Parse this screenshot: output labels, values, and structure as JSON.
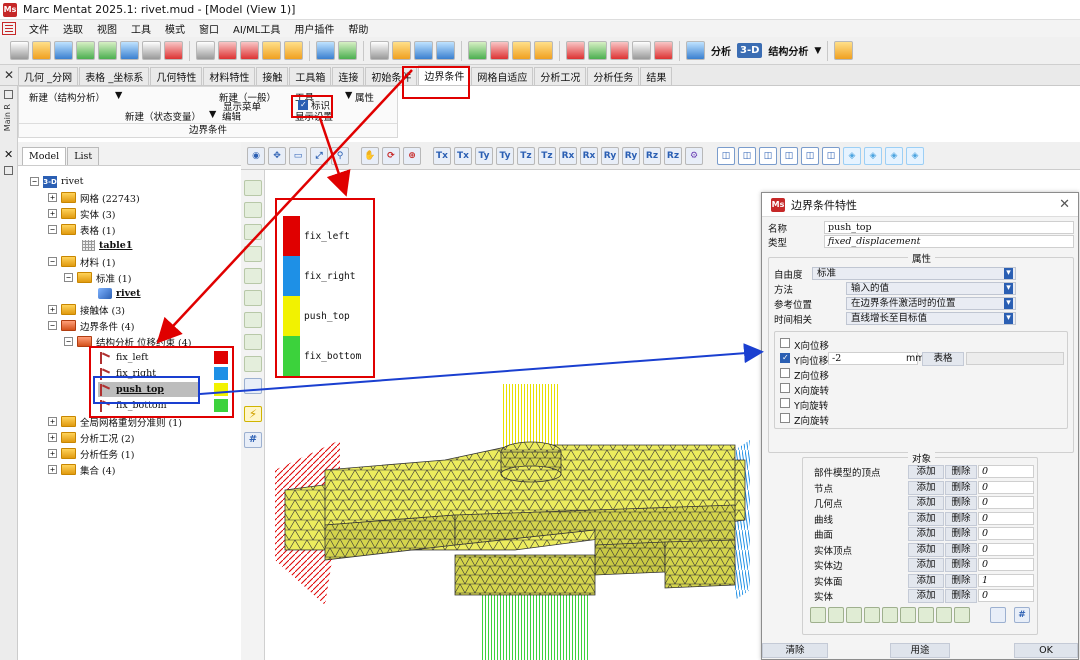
{
  "window": {
    "title": "Marc Mentat 2025.1: rivet.mud - [Model (View 1)]",
    "app_icon": "Ms"
  },
  "menubar": {
    "items": [
      "文件",
      "选取",
      "视图",
      "工具",
      "模式",
      "窗口",
      "AI/ML工具",
      "用户插件",
      "帮助"
    ]
  },
  "toolbar": {
    "analysis_label": "分析",
    "mode_3d": "3-D",
    "analysis_type": "结构分析"
  },
  "tabs": [
    "几何 _分网",
    "表格 _坐标系",
    "几何特性",
    "材料特性",
    "接触",
    "工具箱",
    "连接",
    "初始条件",
    "边界条件",
    "网格自适应",
    "分析工况",
    "分析任务",
    "结果"
  ],
  "active_tab": "边界条件",
  "ribbon": {
    "new_structural": "新建（结构分析）",
    "new_general": "新建（一般）",
    "tools": "工具",
    "properties": "属性",
    "show_menu": "显示菜单",
    "new_state_var": "新建（状态变量）",
    "edit": "编辑",
    "show_settings": "显示设置",
    "label_checkbox": "标识",
    "group_title": "边界条件",
    "side_label": "Main R"
  },
  "panel": {
    "tabs": [
      "Model",
      "List"
    ],
    "tree": {
      "root": "rivet",
      "root_badge": "3-D",
      "items": [
        {
          "label": "网格 (22743)"
        },
        {
          "label": "实体 (3)"
        },
        {
          "label": "表格 (1)"
        },
        {
          "label": "table1"
        },
        {
          "label": "材料 (1)"
        },
        {
          "label": "标准 (1)"
        },
        {
          "label": "rivet"
        },
        {
          "label": "接触体 (3)"
        },
        {
          "label": "边界条件 (4)"
        },
        {
          "label": "结构分析 位移约束 (4)"
        },
        {
          "label": "fix_left",
          "color": "#e00000"
        },
        {
          "label": "fix_right",
          "color": "#1e90e6"
        },
        {
          "label": "push_top",
          "color": "#f2f200"
        },
        {
          "label": "fix_bottom",
          "color": "#3cd23c"
        },
        {
          "label": "全局网格重划分准则 (1)"
        },
        {
          "label": "分析工况 (2)"
        },
        {
          "label": "分析任务 (1)"
        },
        {
          "label": "集合 (4)"
        }
      ]
    }
  },
  "legend": {
    "items": [
      {
        "label": "fix_left",
        "color": "#e00000"
      },
      {
        "label": "fix_right",
        "color": "#1e90e6"
      },
      {
        "label": "push_top",
        "color": "#f2f200"
      },
      {
        "label": "fix_bottom",
        "color": "#3cd23c"
      }
    ]
  },
  "viewport_toolbar": {
    "buttons": [
      "Tx",
      "Tx",
      "Ty",
      "Ty",
      "Tz",
      "Tz",
      "Rx",
      "Rx",
      "Ry",
      "Ry",
      "Rz",
      "Rz"
    ]
  },
  "dialog": {
    "title": "边界条件特性",
    "name_label": "名称",
    "name_value": "push_top",
    "type_label": "类型",
    "type_value": "fixed_displacement",
    "attr_group": "属性",
    "dof_label": "自由度",
    "dof_value": "标准",
    "method_label": "方法",
    "method_value": "输入的值",
    "ref_label": "参考位置",
    "ref_value": "在边界条件激活时的位置",
    "time_label": "时间相关",
    "time_value": "直线增长至目标值",
    "dofs": [
      {
        "label": "X向位移",
        "checked": false
      },
      {
        "label": "Y向位移",
        "checked": true,
        "value": "-2",
        "unit": "mm",
        "table_btn": "表格"
      },
      {
        "label": "Z向位移",
        "checked": false
      },
      {
        "label": "X向旋转",
        "checked": false
      },
      {
        "label": "Y向旋转",
        "checked": false
      },
      {
        "label": "Z向旋转",
        "checked": false
      }
    ],
    "objects_group": "对象",
    "add_label": "添加",
    "remove_label": "删除",
    "objects": [
      {
        "label": "部件模型的顶点",
        "count": "0"
      },
      {
        "label": "节点",
        "count": "0"
      },
      {
        "label": "几何点",
        "count": "0"
      },
      {
        "label": "曲线",
        "count": "0"
      },
      {
        "label": "曲面",
        "count": "0"
      },
      {
        "label": "实体顶点",
        "count": "0"
      },
      {
        "label": "实体边",
        "count": "0"
      },
      {
        "label": "实体面",
        "count": "1"
      },
      {
        "label": "实体",
        "count": "0"
      }
    ],
    "footer": {
      "clear": "清除",
      "apply": "用途",
      "ok": "OK"
    }
  },
  "colors": {
    "accent_red": "#e00000",
    "accent_blue": "#1a3fd0",
    "mesh_yellow": "#eded5a"
  }
}
